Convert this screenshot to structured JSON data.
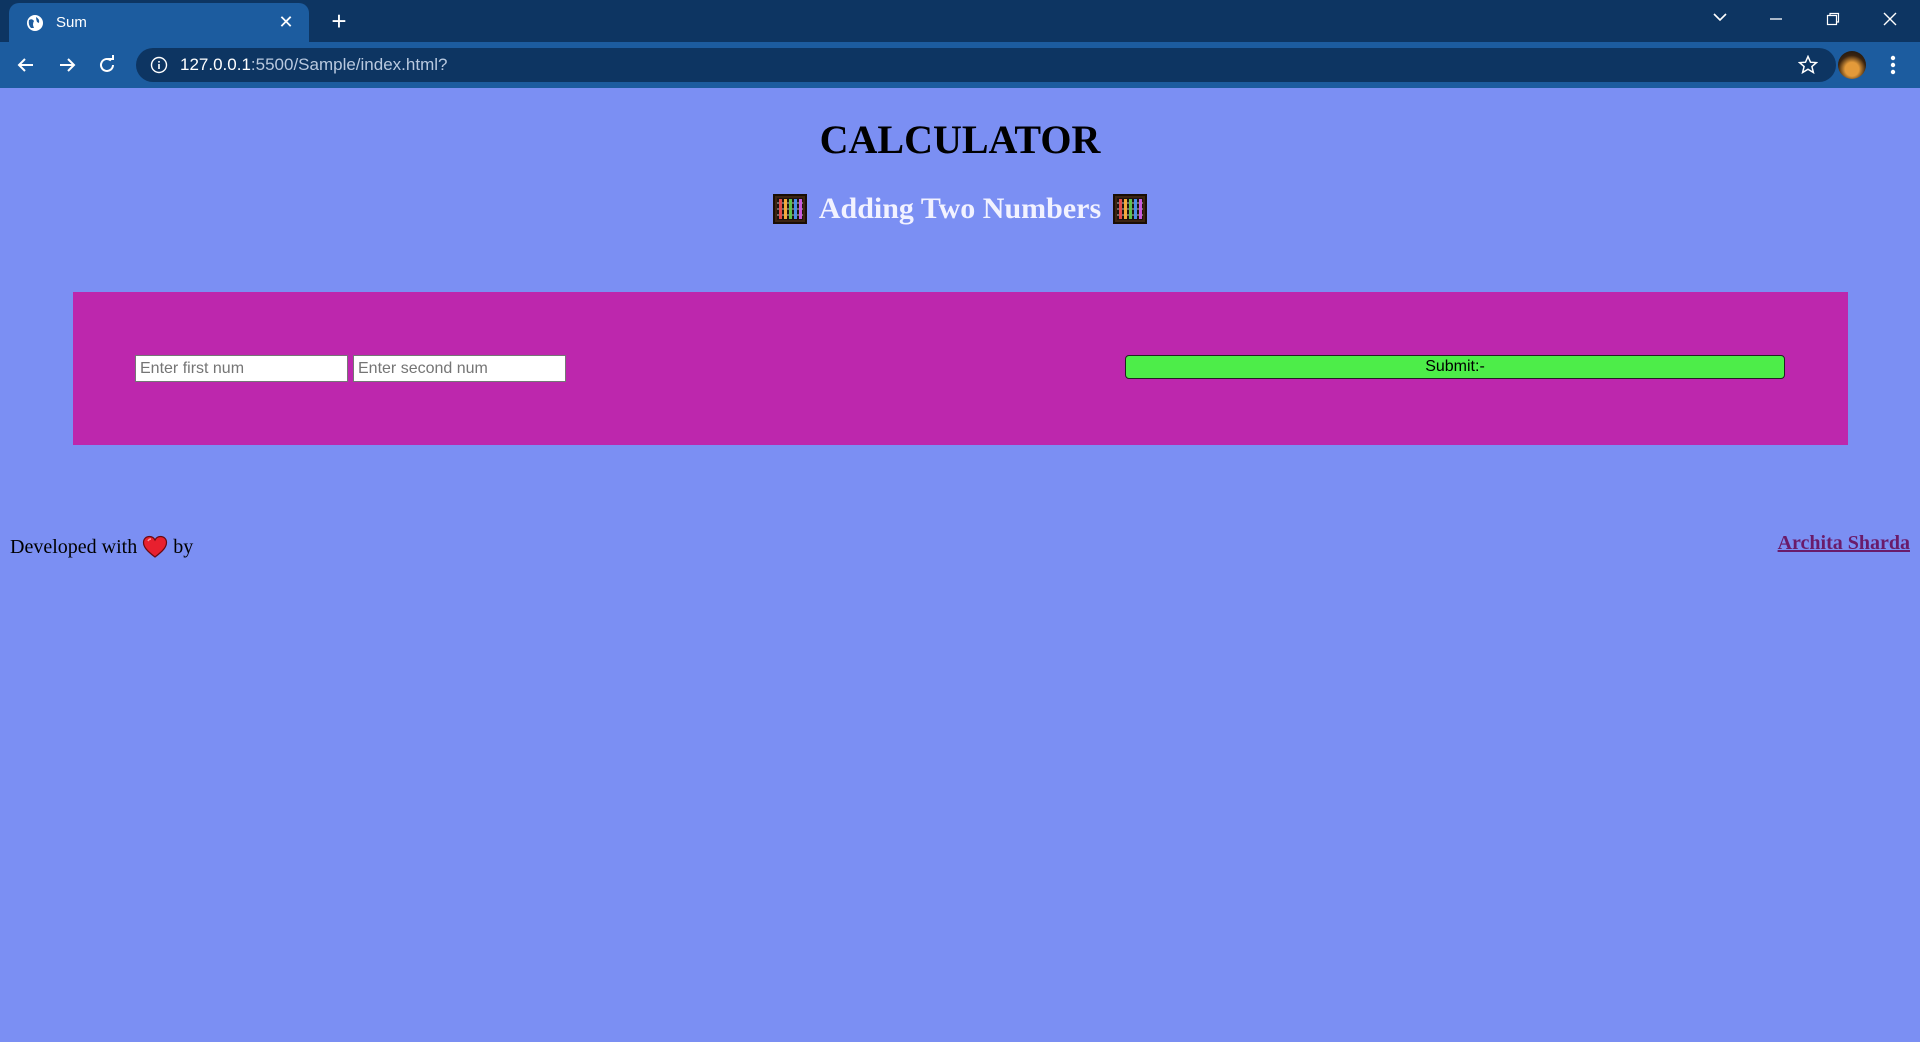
{
  "browser": {
    "tab_title": "Sum",
    "url_host": "127.0.0.1",
    "url_rest": ":5500/Sample/index.html?"
  },
  "page": {
    "title": "CALCULATOR",
    "subtitle": "Adding Two Numbers",
    "form": {
      "first_placeholder": "Enter first num",
      "second_placeholder": "Enter second num",
      "submit_label": "Submit:-"
    },
    "footer": {
      "developed_with": "Developed with",
      "by": "by",
      "author": "Archita Sharda"
    }
  },
  "colors": {
    "page_bg": "#7b8ff3",
    "box_bg": "#bd27ad",
    "submit_bg": "#4ded49",
    "tabstrip_bg": "#0d3562",
    "toolbar_bg": "#1c5c9f"
  },
  "icons": {
    "title_left": "abacus-icon",
    "title_right": "abacus-icon",
    "footer": "heart-icon"
  }
}
